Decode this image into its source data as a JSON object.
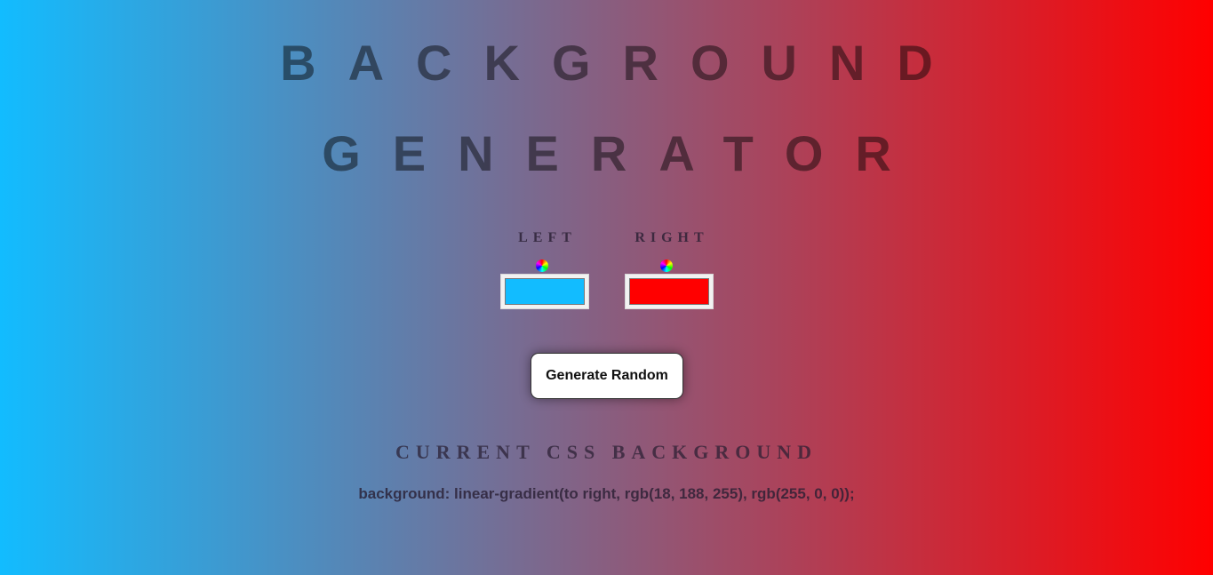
{
  "title": {
    "line1": "BACKGROUND",
    "line2": "GENERATOR"
  },
  "pickers": {
    "left": {
      "label": "LEFT",
      "color": "#12bcff"
    },
    "right": {
      "label": "RIGHT",
      "color": "#ff0000"
    }
  },
  "generate_button": {
    "label": "Generate Random"
  },
  "css_section": {
    "heading": "CURRENT CSS BACKGROUND",
    "value": "background: linear-gradient(to right, rgb(18, 188, 255), rgb(255, 0, 0));"
  },
  "colors": {
    "gradient_left": "#12bcff",
    "gradient_right": "#ff0000"
  }
}
